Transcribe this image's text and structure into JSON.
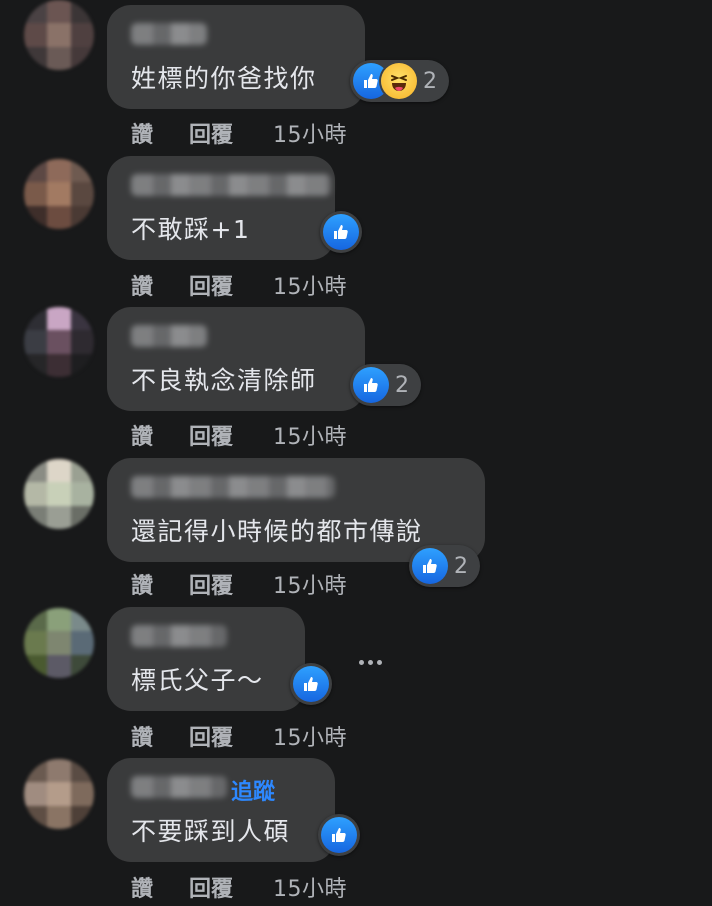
{
  "comments": [
    {
      "text": "姓標的你爸找你",
      "reactions": [
        "like-icon",
        "haha-icon"
      ],
      "reaction_count": "2",
      "actions": {
        "like": "讚",
        "reply": "回覆",
        "time": "15小時"
      }
    },
    {
      "text": "不敢踩+1",
      "reactions": [
        "like-icon"
      ],
      "reaction_count": "",
      "actions": {
        "like": "讚",
        "reply": "回覆",
        "time": "15小時"
      }
    },
    {
      "text": "不良執念清除師",
      "reactions": [
        "like-icon"
      ],
      "reaction_count": "2",
      "actions": {
        "like": "讚",
        "reply": "回覆",
        "time": "15小時"
      }
    },
    {
      "text": "還記得小時候的都市傳說",
      "reactions": [
        "like-icon"
      ],
      "reaction_count": "2",
      "actions": {
        "like": "讚",
        "reply": "回覆",
        "time": "15小時"
      }
    },
    {
      "text": "標氏父子～",
      "reactions": [
        "like-icon"
      ],
      "reaction_count": "",
      "more_icon": "more-options-icon",
      "actions": {
        "like": "讚",
        "reply": "回覆",
        "time": "15小時"
      }
    },
    {
      "text": "不要踩到人碩",
      "follow": "追蹤",
      "reactions": [
        "like-icon"
      ],
      "reaction_count": "",
      "actions": {
        "like": "讚",
        "reply": "回覆",
        "time": "15小時"
      }
    }
  ],
  "colors": {
    "background": "#18191a",
    "bubble": "#3a3b3c",
    "text": "#e4e6eb",
    "secondary_text": "#b0b3b8",
    "link": "#2d88ff",
    "like": "#1877f2",
    "haha": "#f7b125"
  }
}
